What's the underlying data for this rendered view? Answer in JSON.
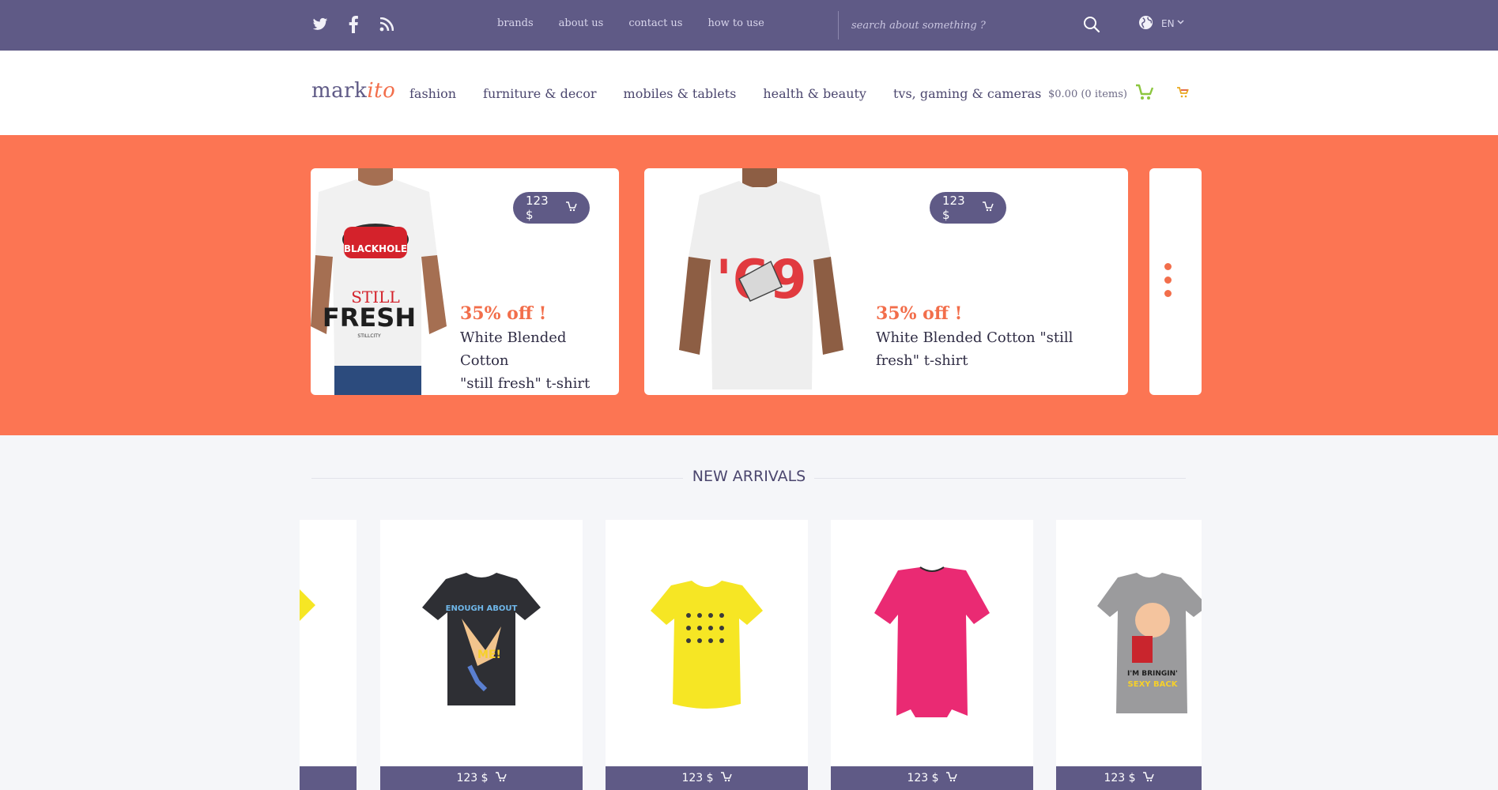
{
  "topbar": {
    "social": [
      "twitter-icon",
      "facebook-icon",
      "rss-icon"
    ],
    "nav": [
      "brands",
      "about us",
      "contact us",
      "how to use"
    ],
    "search_placeholder": "search about something ?",
    "language": "EN"
  },
  "header": {
    "logo_main": "mark",
    "logo_accent": "ito",
    "nav": [
      "fashion",
      "furniture & decor",
      "mobiles & tablets",
      "health & beauty",
      "tvs, gaming & cameras"
    ],
    "cart_summary": "$0.00 (0 items)"
  },
  "hero": {
    "slides": [
      {
        "price": "123 $",
        "discount": "35% off !",
        "name_line1": "White Blended Cotton",
        "name_line2": "\"still fresh\" t-shirt",
        "print_top": "BLACKHOLE",
        "print_bottom": "FRESH",
        "print_still": "STILL",
        "print_sub": "STILLCITY"
      },
      {
        "price": "123 $",
        "discount": "35% off !",
        "name_line1": "White Blended Cotton \"still",
        "name_line2": "fresh\" t-shirt",
        "print_top": "'69"
      }
    ]
  },
  "new_arrivals": {
    "title": "NEW ARRIVALS",
    "products": [
      {
        "price": "123 $",
        "color": "#2e2f34",
        "print1": "ENOUGH ABOUT",
        "print2": "ME!"
      },
      {
        "price": "123 $",
        "color": "#f6e624"
      },
      {
        "price": "123 $",
        "color": "#ea2a73"
      },
      {
        "price": "123 $",
        "color": "#9b9b9d",
        "print1": "I'M BRINGIN'",
        "print2": "SEXY BACK"
      }
    ]
  },
  "colors": {
    "primary": "#5f5a86",
    "accent": "#fc7553",
    "accent_text": "#f26e4b"
  }
}
